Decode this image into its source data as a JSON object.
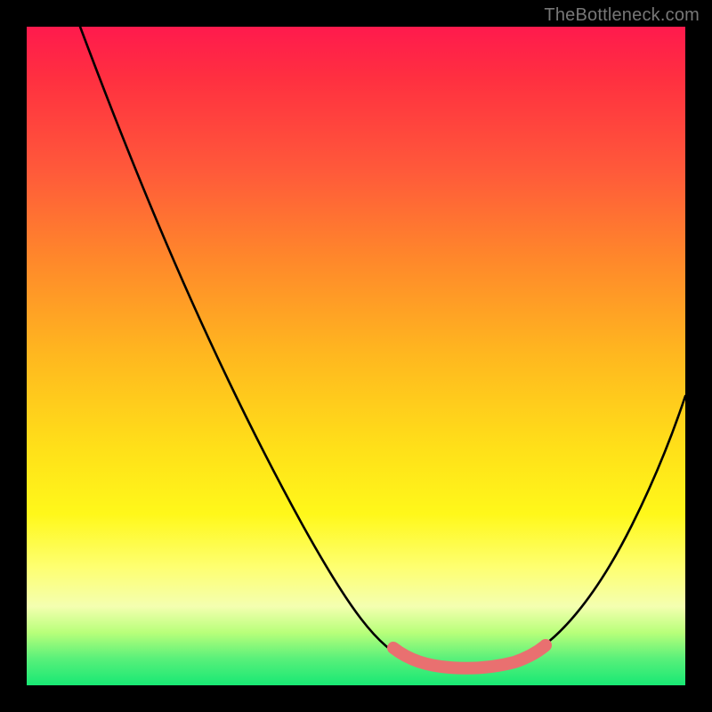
{
  "watermark": "TheBottleneck.com",
  "chart_data": {
    "type": "line",
    "title": "",
    "xlabel": "",
    "ylabel": "",
    "xlim": [
      0,
      100
    ],
    "ylim": [
      0,
      100
    ],
    "series": [
      {
        "name": "bottleneck-curve",
        "x": [
          8,
          15,
          22,
          29,
          36,
          43,
          50,
          55,
          58,
          60,
          63,
          66,
          70,
          74,
          78,
          82,
          86,
          90,
          95,
          100
        ],
        "y": [
          100,
          88,
          76,
          64,
          52,
          40,
          28,
          18,
          11,
          7,
          4,
          3,
          3,
          4,
          6,
          12,
          20,
          30,
          42,
          55
        ]
      }
    ],
    "highlight_band": {
      "name": "optimal-range",
      "x_start": 57,
      "x_end": 78,
      "y_approx": 4
    },
    "gradient_stops": [
      {
        "pos": 0,
        "color": "#ff1a4d"
      },
      {
        "pos": 22,
        "color": "#ff5a3a"
      },
      {
        "pos": 50,
        "color": "#ffb81f"
      },
      {
        "pos": 74,
        "color": "#fff81a"
      },
      {
        "pos": 88,
        "color": "#f4ffb0"
      },
      {
        "pos": 100,
        "color": "#18e874"
      }
    ]
  }
}
